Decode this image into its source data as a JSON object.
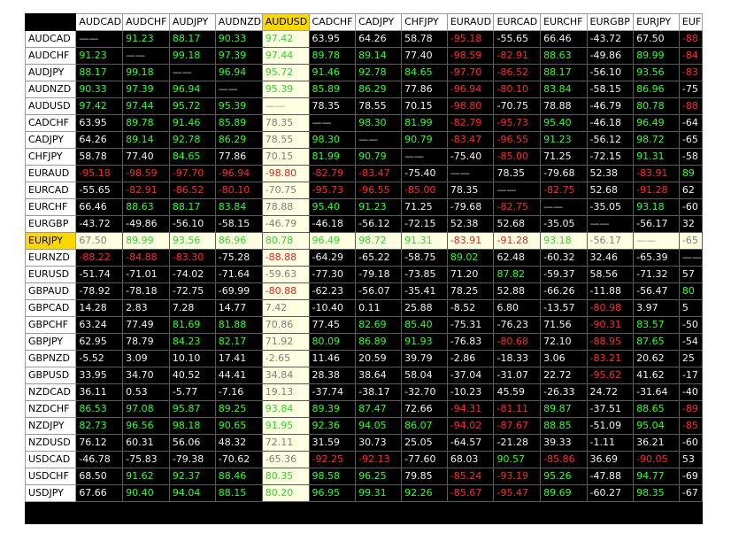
{
  "columns": [
    "AUDCAD",
    "AUDCHF",
    "AUDJPY",
    "AUDNZD",
    "AUDUSD",
    "CADCHF",
    "CADJPY",
    "CHFJPY",
    "EURAUD",
    "EURCAD",
    "EURCHF",
    "EURGBP",
    "EURJPY",
    "EUF"
  ],
  "highlight_column": "AUDUSD",
  "highlight_row": "EURJPY",
  "colors": {
    "positive": "#2cff2c",
    "negative": "#ff2a2a",
    "neutral": "#f2f2f2",
    "highlight": "#ffd700",
    "highlight_bg": "#fefee0",
    "background": "#000000"
  },
  "rows": [
    {
      "name": "AUDCAD",
      "cells": [
        "——",
        "91.23",
        "88.17",
        "90.33",
        "97.42",
        "63.95",
        "64.26",
        "58.78",
        "-95.18",
        "-55.65",
        "66.46",
        "-43.72",
        "67.50",
        "-88"
      ]
    },
    {
      "name": "AUDCHF",
      "cells": [
        "91.23",
        "——",
        "99.18",
        "97.39",
        "97.44",
        "89.78",
        "89.14",
        "77.40",
        "-98.59",
        "-82.91",
        "88.63",
        "-49.86",
        "89.99",
        "-84"
      ]
    },
    {
      "name": "AUDJPY",
      "cells": [
        "88.17",
        "99.18",
        "——",
        "96.94",
        "95.72",
        "91.46",
        "92.78",
        "84.65",
        "-97.70",
        "-86.52",
        "88.17",
        "-56.10",
        "93.56",
        "-83"
      ]
    },
    {
      "name": "AUDNZD",
      "cells": [
        "90.33",
        "97.39",
        "96.94",
        "——",
        "95.39",
        "85.89",
        "86.29",
        "77.86",
        "-96.94",
        "-80.10",
        "83.84",
        "-58.15",
        "86.96",
        "-75"
      ]
    },
    {
      "name": "AUDUSD",
      "cells": [
        "97.42",
        "97.44",
        "95.72",
        "95.39",
        "——",
        "78.35",
        "78.55",
        "70.15",
        "-98.80",
        "-70.75",
        "78.88",
        "-46.79",
        "80.78",
        "-88"
      ]
    },
    {
      "name": "CADCHF",
      "cells": [
        "63.95",
        "89.78",
        "91.46",
        "85.89",
        "78.35",
        "——",
        "98.30",
        "81.99",
        "-82.79",
        "-95.73",
        "95.40",
        "-46.18",
        "96.49",
        "-64"
      ]
    },
    {
      "name": "CADJPY",
      "cells": [
        "64.26",
        "89.14",
        "92.78",
        "86.29",
        "78.55",
        "98.30",
        "——",
        "90.79",
        "-83.47",
        "-96.55",
        "91.23",
        "-56.12",
        "98.72",
        "-65"
      ]
    },
    {
      "name": "CHFJPY",
      "cells": [
        "58.78",
        "77.40",
        "84.65",
        "77.86",
        "70.15",
        "81.99",
        "90.79",
        "——",
        "-75.40",
        "-85.00",
        "71.25",
        "-72.15",
        "91.31",
        "-58"
      ]
    },
    {
      "name": "EURAUD",
      "cells": [
        "-95.18",
        "-98.59",
        "-97.70",
        "-96.94",
        "-98.80",
        "-82.79",
        "-83.47",
        "-75.40",
        "——",
        "78.35",
        "-79.68",
        "52.38",
        "-83.91",
        "89"
      ]
    },
    {
      "name": "EURCAD",
      "cells": [
        "-55.65",
        "-82.91",
        "-86.52",
        "-80.10",
        "-70.75",
        "-95.73",
        "-96.55",
        "-85.00",
        "78.35",
        "——",
        "-82.75",
        "52.68",
        "-91.28",
        "62"
      ]
    },
    {
      "name": "EURCHF",
      "cells": [
        "66.46",
        "88.63",
        "88.17",
        "83.84",
        "78.88",
        "95.40",
        "91.23",
        "71.25",
        "-79.68",
        "-82.75",
        "——",
        "-35.05",
        "93.18",
        "-60"
      ]
    },
    {
      "name": "EURGBP",
      "cells": [
        "-43.72",
        "-49.86",
        "-56.10",
        "-58.15",
        "-46.79",
        "-46.18",
        "-56.12",
        "-72.15",
        "52.38",
        "52.68",
        "-35.05",
        "——",
        "-56.17",
        "32"
      ]
    },
    {
      "name": "EURJPY",
      "cells": [
        "67.50",
        "89.99",
        "93.56",
        "86.96",
        "80.78",
        "96.49",
        "98.72",
        "91.31",
        "-83.91",
        "-91.28",
        "93.18",
        "-56.17",
        "——",
        "-65"
      ]
    },
    {
      "name": "EURNZD",
      "cells": [
        "-88.22",
        "-84.88",
        "-83.30",
        "-75.28",
        "-88.88",
        "-64.29",
        "-65.22",
        "-58.75",
        "89.02",
        "62.48",
        "-60.32",
        "32.46",
        "-65.39",
        "——"
      ]
    },
    {
      "name": "EURUSD",
      "cells": [
        "-51.74",
        "-71.01",
        "-74.02",
        "-71.64",
        "-59.63",
        "-77.30",
        "-79.18",
        "-73.85",
        "71.20",
        "87.82",
        "-59.37",
        "58.56",
        "-71.32",
        "57"
      ]
    },
    {
      "name": "GBPAUD",
      "cells": [
        "-78.92",
        "-78.18",
        "-72.75",
        "-69.99",
        "-80.88",
        "-62.23",
        "-56.07",
        "-35.41",
        "78.25",
        "52.88",
        "-66.26",
        "-11.88",
        "-56.47",
        "80"
      ]
    },
    {
      "name": "GBPCAD",
      "cells": [
        "14.28",
        "2.83",
        "7.28",
        "14.77",
        "7.42",
        "-10.40",
        "0.11",
        "25.88",
        "-8.52",
        "6.80",
        "-13.57",
        "-80.98",
        "3.97",
        "5"
      ]
    },
    {
      "name": "GBPCHF",
      "cells": [
        "63.24",
        "77.49",
        "81.69",
        "81.88",
        "70.86",
        "77.45",
        "82.69",
        "85.40",
        "-75.31",
        "-76.23",
        "71.56",
        "-90.31",
        "83.57",
        "-50"
      ]
    },
    {
      "name": "GBPJPY",
      "cells": [
        "62.95",
        "78.79",
        "84.23",
        "82.17",
        "71.92",
        "80.09",
        "86.89",
        "91.93",
        "-76.83",
        "-80.68",
        "72.10",
        "-88.95",
        "87.65",
        "-54"
      ]
    },
    {
      "name": "GBPNZD",
      "cells": [
        "-5.52",
        "3.09",
        "10.10",
        "17.41",
        "-2.65",
        "11.46",
        "20.59",
        "39.79",
        "-2.86",
        "-18.33",
        "3.06",
        "-83.21",
        "20.62",
        "25"
      ]
    },
    {
      "name": "GBPUSD",
      "cells": [
        "33.95",
        "34.70",
        "40.52",
        "44.41",
        "34.84",
        "28.38",
        "38.64",
        "58.04",
        "-37.04",
        "-31.07",
        "22.72",
        "-95.62",
        "41.62",
        "-17"
      ]
    },
    {
      "name": "NZDCAD",
      "cells": [
        "36.11",
        "0.53",
        "-5.77",
        "-7.16",
        "19.13",
        "-37.74",
        "-38.17",
        "-32.70",
        "-10.23",
        "45.59",
        "-26.33",
        "24.72",
        "-31.64",
        "-40"
      ]
    },
    {
      "name": "NZDCHF",
      "cells": [
        "86.53",
        "97.08",
        "95.87",
        "89.25",
        "93.84",
        "89.39",
        "87.47",
        "72.66",
        "-94.31",
        "-81.11",
        "89.87",
        "-37.51",
        "88.65",
        "-89"
      ]
    },
    {
      "name": "NZDJPY",
      "cells": [
        "82.73",
        "96.56",
        "98.18",
        "90.65",
        "91.95",
        "92.36",
        "94.05",
        "86.07",
        "-94.02",
        "-87.67",
        "88.85",
        "-51.09",
        "95.04",
        "-85"
      ]
    },
    {
      "name": "NZDUSD",
      "cells": [
        "76.12",
        "60.31",
        "56.06",
        "48.32",
        "72.11",
        "31.59",
        "30.73",
        "25.05",
        "-64.57",
        "-21.28",
        "39.33",
        "-1.11",
        "36.21",
        "-60"
      ]
    },
    {
      "name": "USDCAD",
      "cells": [
        "-46.78",
        "-75.83",
        "-79.38",
        "-70.62",
        "-65.36",
        "-92.25",
        "-92.13",
        "-77.60",
        "68.03",
        "90.57",
        "-85.86",
        "36.69",
        "-90.05",
        "53"
      ]
    },
    {
      "name": "USDCHF",
      "cells": [
        "68.50",
        "91.62",
        "92.37",
        "88.46",
        "80.35",
        "98.58",
        "96.25",
        "79.85",
        "-85.24",
        "-93.19",
        "95.26",
        "-47.88",
        "94.77",
        "-69"
      ]
    },
    {
      "name": "USDJPY",
      "cells": [
        "67.66",
        "90.40",
        "94.04",
        "88.15",
        "80.20",
        "96.95",
        "99.31",
        "92.26",
        "-85.67",
        "-95.47",
        "89.69",
        "-60.27",
        "98.35",
        "-67"
      ]
    }
  ]
}
